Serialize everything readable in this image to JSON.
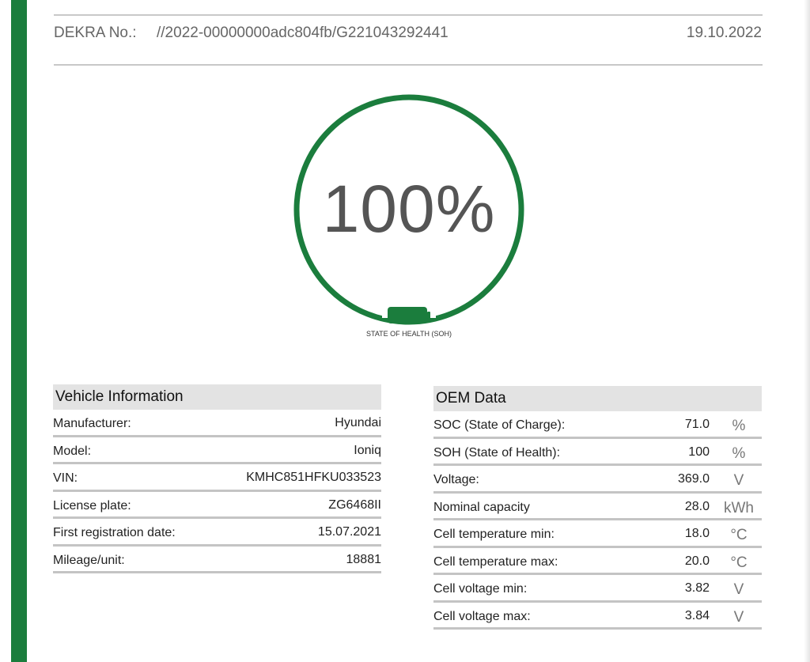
{
  "colors": {
    "accent": "#1b7d3d",
    "rule": "#c8c8c8"
  },
  "header": {
    "label": "DEKRA No.:",
    "number": "//2022-00000000adc804fb/G221043292441",
    "date": "19.10.2022"
  },
  "gauge": {
    "value_text": "100%",
    "value": 100,
    "caption": "STATE OF HEALTH (SOH)",
    "icon": "battery-icon"
  },
  "vehicle": {
    "title": "Vehicle Information",
    "rows": [
      {
        "label": "Manufacturer:",
        "value": "Hyundai"
      },
      {
        "label": "Model:",
        "value": "Ioniq"
      },
      {
        "label": "VIN:",
        "value": "KMHC851HFKU033523"
      },
      {
        "label": "License plate:",
        "value": "ZG6468II"
      },
      {
        "label": "First registration date:",
        "value": "15.07.2021"
      },
      {
        "label": "Mileage/unit:",
        "value": "18881"
      }
    ]
  },
  "oem": {
    "title": "OEM Data",
    "rows": [
      {
        "label": "SOC (State of Charge):",
        "value": "71.0",
        "unit": "%"
      },
      {
        "label": "SOH (State of Health):",
        "value": "100",
        "unit": "%"
      },
      {
        "label": "Voltage:",
        "value": "369.0",
        "unit": "V"
      },
      {
        "label": "Nominal capacity",
        "value": "28.0",
        "unit": "kWh"
      },
      {
        "label": "Cell temperature min:",
        "value": "18.0",
        "unit": "°C"
      },
      {
        "label": "Cell temperature max:",
        "value": "20.0",
        "unit": "°C"
      },
      {
        "label": "Cell voltage min:",
        "value": "3.82",
        "unit": "V"
      },
      {
        "label": "Cell voltage max:",
        "value": "3.84",
        "unit": "V"
      }
    ]
  }
}
